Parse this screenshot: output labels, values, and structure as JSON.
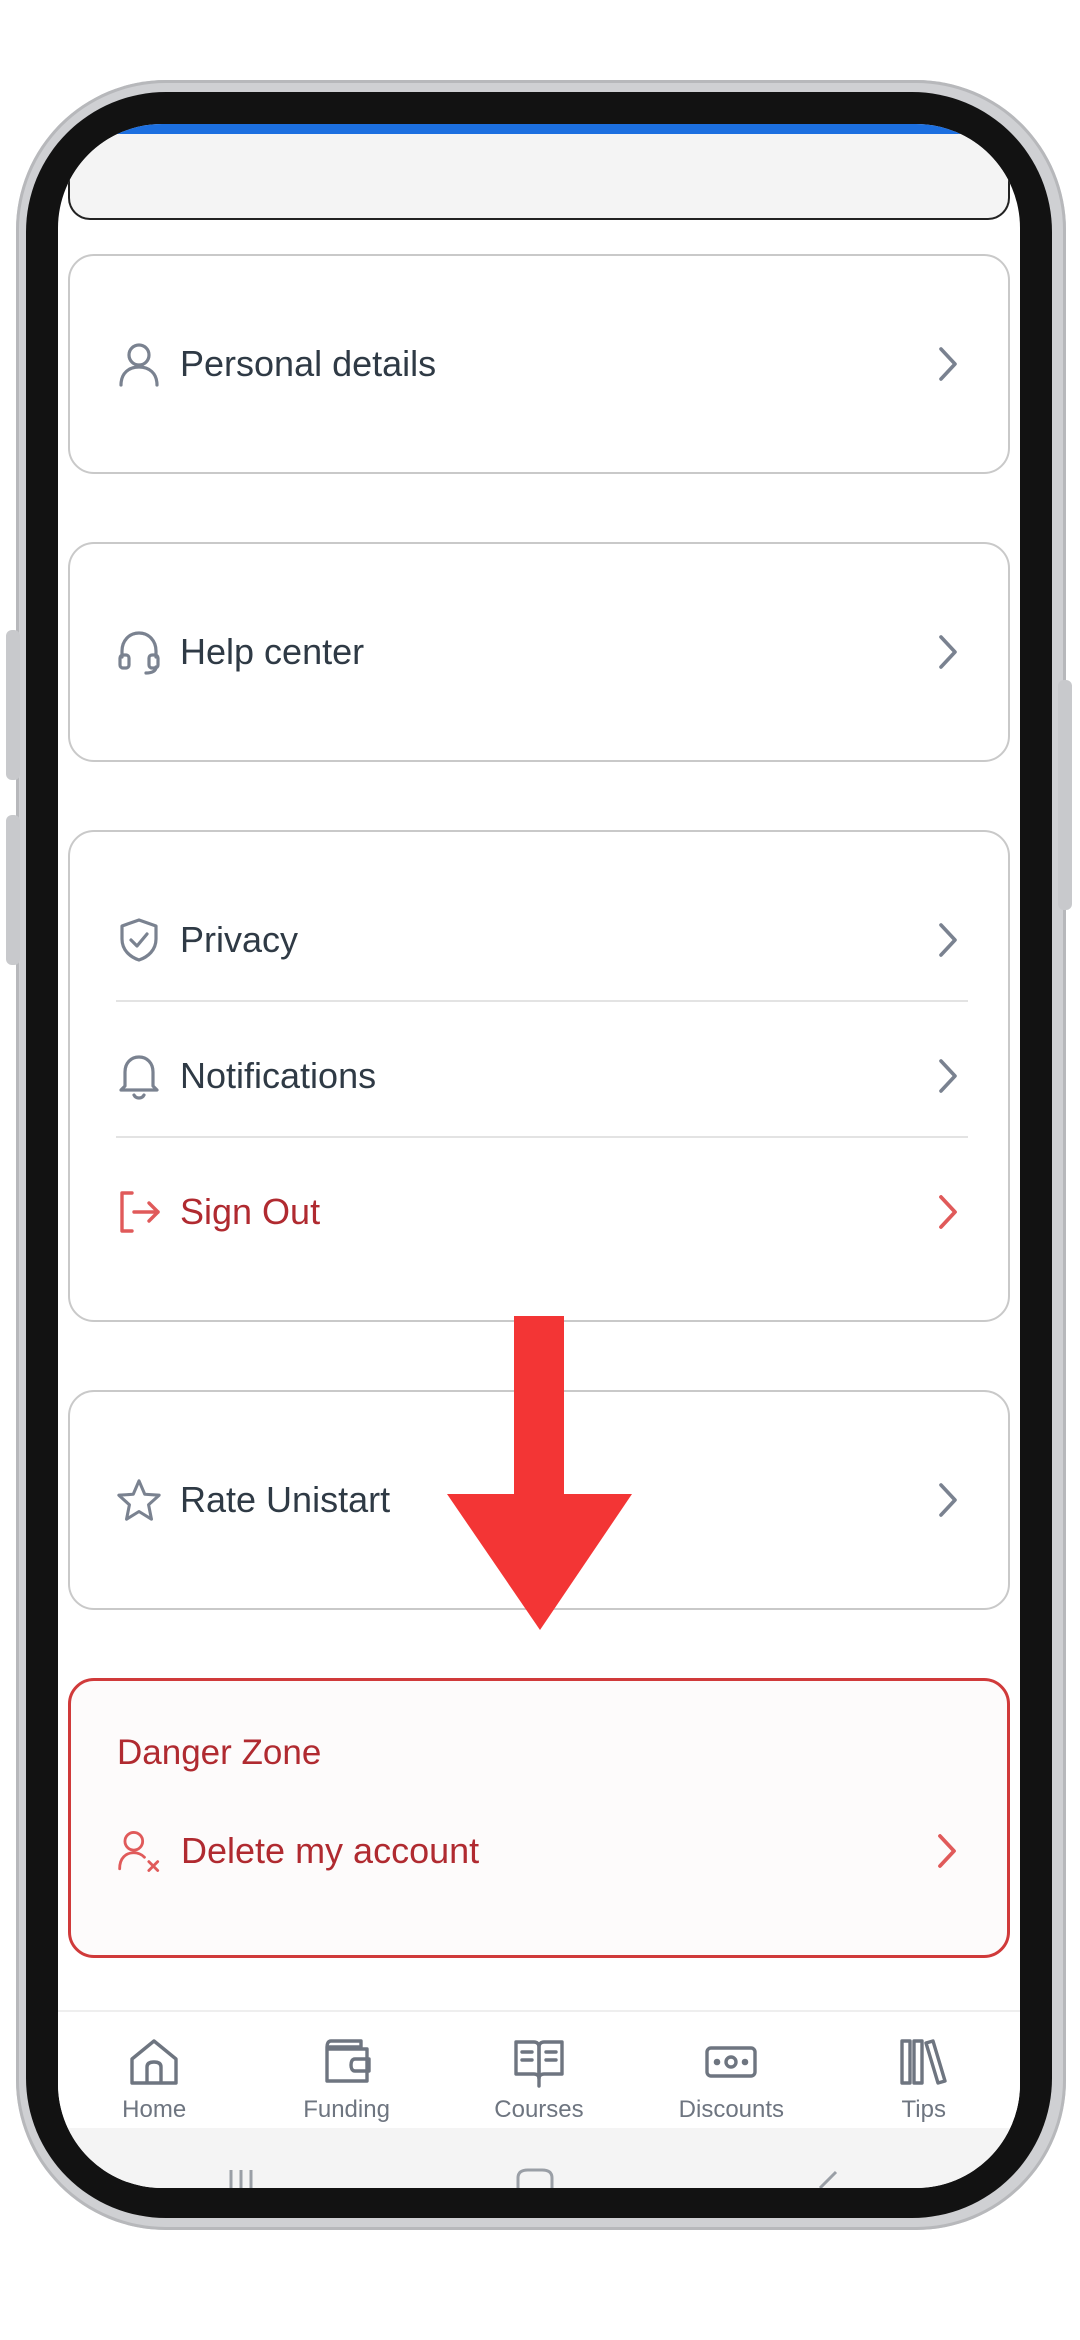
{
  "settings": {
    "personal_details": "Personal details",
    "help_center": "Help center",
    "privacy": "Privacy",
    "notifications": "Notifications",
    "sign_out": "Sign Out",
    "rate": "Rate Unistart"
  },
  "danger_zone": {
    "title": "Danger Zone",
    "delete_account": "Delete my account"
  },
  "bottom_nav": {
    "home": "Home",
    "funding": "Funding",
    "courses": "Courses",
    "discounts": "Discounts",
    "tips": "Tips"
  },
  "colors": {
    "text": "#2f3a45",
    "danger": "#b02a30",
    "accent_arrow": "#f33535",
    "top_bar": "#1c6fe0",
    "icon_gray": "#7a8290"
  },
  "icons": {
    "personal_details": "user-icon",
    "help_center": "headset-icon",
    "privacy": "shield-check-icon",
    "notifications": "bell-icon",
    "sign_out": "logout-icon",
    "rate": "star-icon",
    "delete_account": "user-remove-icon"
  }
}
